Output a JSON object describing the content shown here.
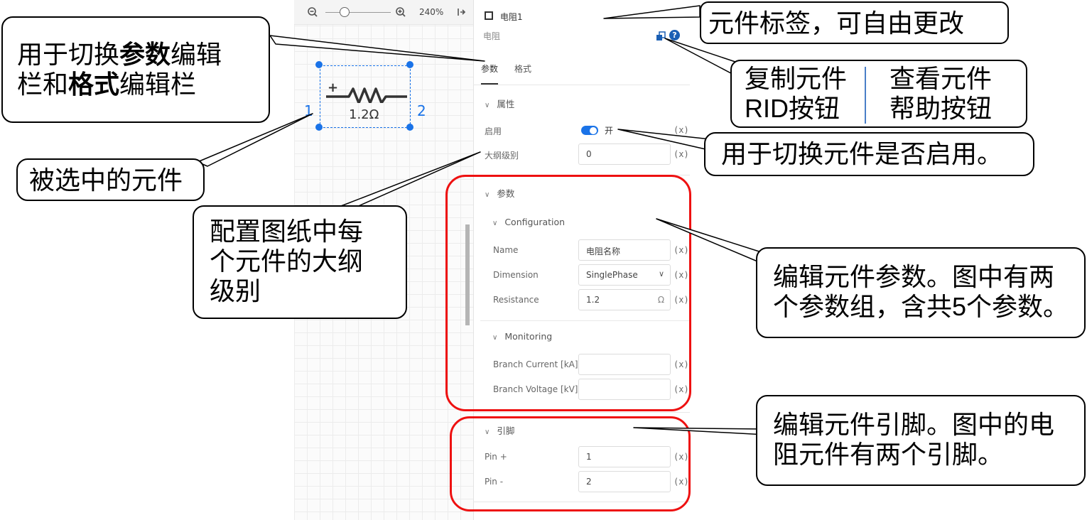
{
  "toolbar": {
    "zoom_value": "240%",
    "zoom_out_icon": "zoom-out-icon",
    "zoom_in_icon": "zoom-in-icon",
    "collapse_icon": "panel-collapse-icon"
  },
  "component": {
    "symbol_plus": "+",
    "value_label": "1.2Ω",
    "pin_left": "1",
    "pin_right": "2"
  },
  "panel": {
    "label": "电阻1",
    "type_name": "电阻",
    "tabs": [
      "参数",
      "格式"
    ],
    "active_tab": "参数",
    "section_props": "属性",
    "enable_label": "启用",
    "enable_state": "开",
    "outline_label": "大纲级别",
    "outline_value": "0",
    "section_params": "参数",
    "group_config": "Configuration",
    "name_label": "Name",
    "name_value": "电阻名称",
    "dimension_label": "Dimension",
    "dimension_value": "SinglePhase",
    "resistance_label": "Resistance",
    "resistance_value": "1.2",
    "resistance_unit": "Ω",
    "group_monitoring": "Monitoring",
    "branch_current_label": "Branch Current [kA]",
    "branch_voltage_label": "Branch Voltage [kV]",
    "section_pins": "引脚",
    "pin_plus_label": "Pin +",
    "pin_plus_value": "1",
    "pin_minus_label": "Pin -",
    "pin_minus_value": "2",
    "expr_button": "(x)"
  },
  "callouts": {
    "tab_switch": {
      "pre": "用于切换",
      "b1": "参数",
      "mid": "编辑",
      "line2a": "栏和",
      "b2": "格式",
      "post": "编辑栏"
    },
    "selected": "被选中的元件",
    "outline": [
      "配置图纸中每",
      "个元件的大纲",
      "级别"
    ],
    "label": "元件标签，可自由更改",
    "copy_rid": [
      "复制元件",
      "RID按钮"
    ],
    "help": [
      "查看元件",
      "帮助按钮"
    ],
    "enable": "用于切换元件是否启用。",
    "params": [
      "编辑元件参数。图中有两",
      "个参数组，含共5个参数。"
    ],
    "pins": [
      "编辑元件引脚。图中的电",
      "阻元件有两个引脚。"
    ]
  },
  "colors": {
    "accent": "#1a73e8",
    "highlight": "#ee1111"
  }
}
